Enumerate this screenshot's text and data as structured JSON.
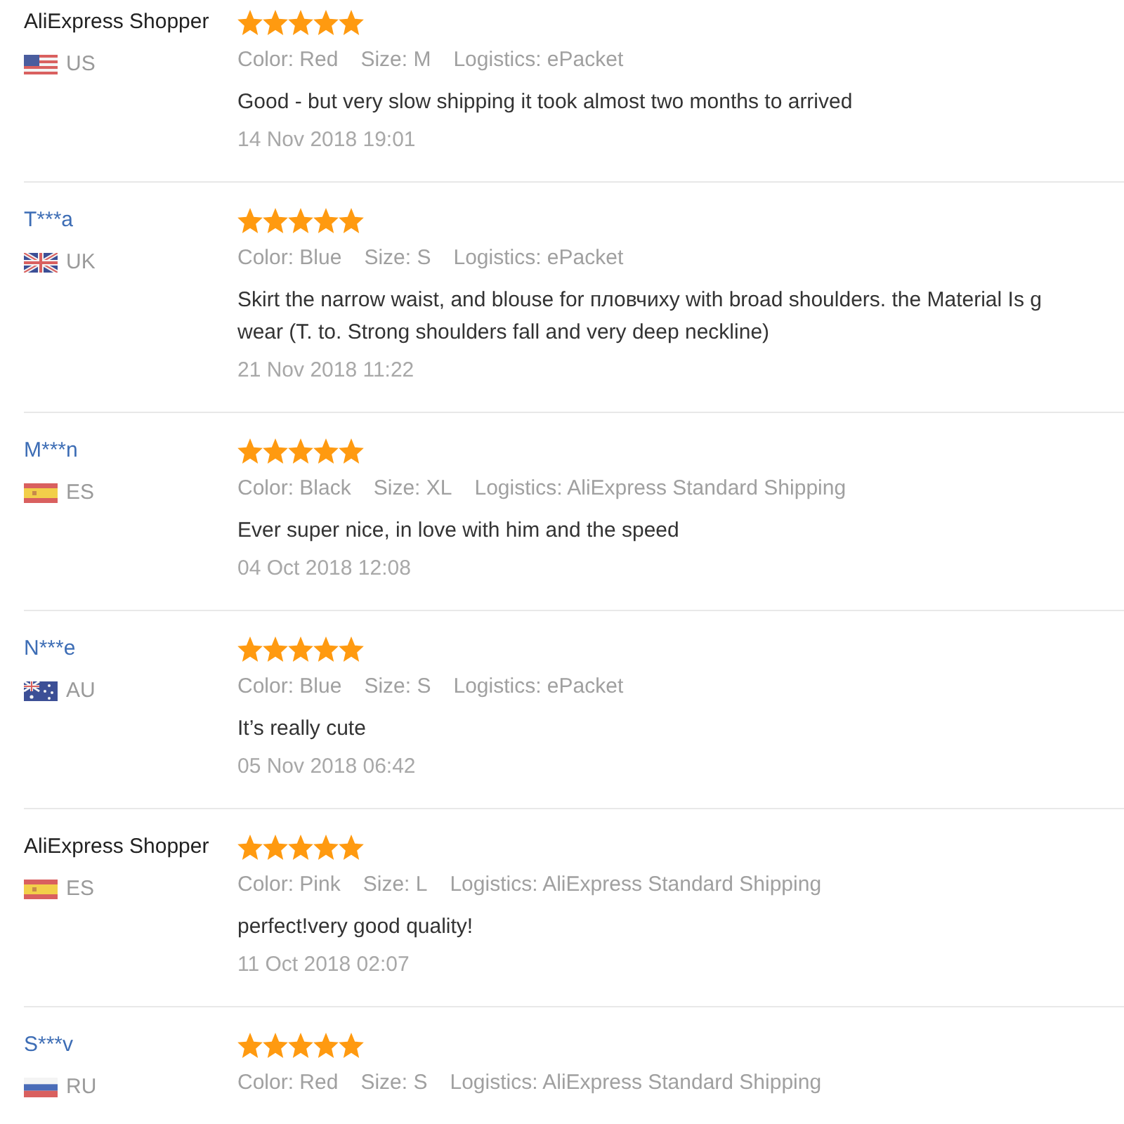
{
  "reviews": [
    {
      "reviewer": {
        "name": "AliExpress Shopper",
        "linked": false
      },
      "country": {
        "code": "US",
        "kind": "us"
      },
      "stars": 5,
      "details": [
        "Color: Red",
        "Size: M",
        "Logistics: ePacket"
      ],
      "text_lines": [
        "Good - but very slow shipping it took almost two months to arrived"
      ],
      "date": "14 Nov 2018 19:01"
    },
    {
      "reviewer": {
        "name": "T***a",
        "linked": true
      },
      "country": {
        "code": "UK",
        "kind": "uk"
      },
      "stars": 5,
      "details": [
        "Color: Blue",
        "Size: S",
        "Logistics: ePacket"
      ],
      "text_lines": [
        "Skirt the narrow waist, and blouse for пловчиху with broad shoulders. the Material Is g",
        "wear (T. to. Strong shoulders fall and very deep neckline)"
      ],
      "date": "21 Nov 2018 11:22"
    },
    {
      "reviewer": {
        "name": "M***n",
        "linked": true
      },
      "country": {
        "code": "ES",
        "kind": "es"
      },
      "stars": 5,
      "details": [
        "Color: Black",
        "Size: XL",
        "Logistics: AliExpress Standard Shipping"
      ],
      "text_lines": [
        "Ever super nice, in love with him and the speed"
      ],
      "date": "04 Oct 2018 12:08"
    },
    {
      "reviewer": {
        "name": "N***e",
        "linked": true
      },
      "country": {
        "code": "AU",
        "kind": "au"
      },
      "stars": 5,
      "details": [
        "Color: Blue",
        "Size: S",
        "Logistics: ePacket"
      ],
      "text_lines": [
        "It’s really cute"
      ],
      "date": "05 Nov 2018 06:42"
    },
    {
      "reviewer": {
        "name": "AliExpress Shopper",
        "linked": false
      },
      "country": {
        "code": "ES",
        "kind": "es"
      },
      "stars": 5,
      "details": [
        "Color: Pink",
        "Size: L",
        "Logistics: AliExpress Standard Shipping"
      ],
      "text_lines": [
        "perfect!very good quality!"
      ],
      "date": "11 Oct 2018 02:07"
    },
    {
      "reviewer": {
        "name": "S***v",
        "linked": true
      },
      "country": {
        "code": "RU",
        "kind": "ru"
      },
      "stars": 5,
      "details": [
        "Color: Red",
        "Size: S",
        "Logistics: AliExpress Standard Shipping"
      ]
    }
  ]
}
